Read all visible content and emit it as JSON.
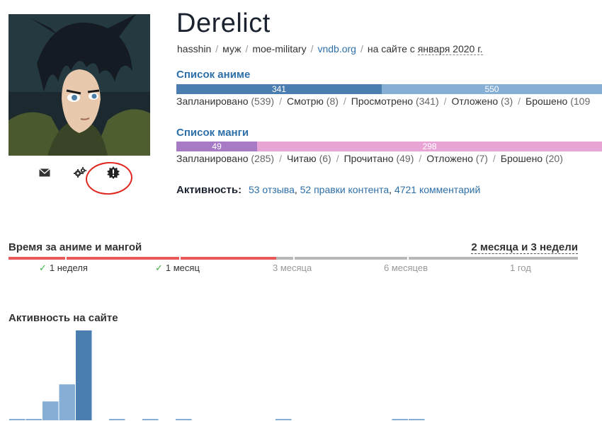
{
  "profile": {
    "username": "Derelict",
    "meta": {
      "login": "hasshin",
      "gender": "муж",
      "group": "moe-military",
      "vndb_link": "vndb.org",
      "since_prefix": "на сайте с",
      "since_date": "января 2020 г."
    },
    "actions": [
      {
        "name": "mail-icon",
        "glyph": "✉"
      },
      {
        "name": "settings-icon",
        "glyph": "⚙"
      },
      {
        "name": "badge-icon",
        "glyph": "✸"
      }
    ]
  },
  "anime_list": {
    "title": "Список аниме",
    "bar": [
      {
        "value": "341",
        "fraction": 0.4824,
        "color": "#4a7eb0"
      },
      {
        "value": "550",
        "fraction": 0.5176,
        "color": "#86afd6"
      }
    ],
    "stats": [
      {
        "label": "Запланировано",
        "count": "(539)"
      },
      {
        "label": "Смотрю",
        "count": "(8)"
      },
      {
        "label": "Просмотрено",
        "count": "(341)"
      },
      {
        "label": "Отложено",
        "count": "(3)"
      },
      {
        "label": "Брошено",
        "count": "(109"
      }
    ]
  },
  "manga_list": {
    "title": "Список манги",
    "bar": [
      {
        "value": "49",
        "fraction": 0.19,
        "color": "#a67ac4"
      },
      {
        "value": "298",
        "fraction": 0.81,
        "color": "#e9a4d6"
      }
    ],
    "stats": [
      {
        "label": "Запланировано",
        "count": "(285)"
      },
      {
        "label": "Читаю",
        "count": "(6)"
      },
      {
        "label": "Прочитано",
        "count": "(49)"
      },
      {
        "label": "Отложено",
        "count": "(7)"
      },
      {
        "label": "Брошено",
        "count": "(20)"
      }
    ]
  },
  "activity": {
    "label": "Активность:",
    "reviews": "53 отзыва",
    "edits": "52 правки контента",
    "comments": "4721 комментарий"
  },
  "time_spent": {
    "title": "Время за аниме и мангой",
    "total": "2 месяца и 3 недели",
    "progress": 0.47,
    "milestones": [
      {
        "label": "1 неделя",
        "done": true
      },
      {
        "label": "1 месяц",
        "done": true
      },
      {
        "label": "3 месяца",
        "done": false
      },
      {
        "label": "6 месяцев",
        "done": false
      },
      {
        "label": "1 год",
        "done": false
      }
    ]
  },
  "site_activity": {
    "title": "Активность на сайте",
    "chart_data": {
      "type": "bar",
      "values": [
        0.012,
        0.012,
        0.21,
        0.4,
        1.0,
        0,
        0.012,
        0,
        0.012,
        0,
        0.012,
        0,
        0,
        0,
        0,
        0,
        0.012,
        0,
        0,
        0,
        0,
        0,
        0,
        0.012,
        0.012
      ],
      "color_light": "#86afd6",
      "color_dark": "#4a7eb0"
    }
  }
}
